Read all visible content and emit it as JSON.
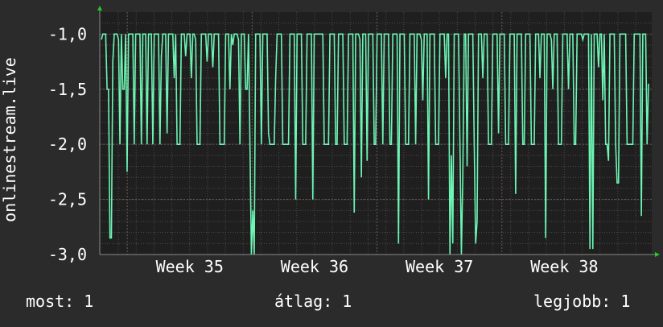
{
  "chart_data": {
    "type": "line",
    "ylabel": "onlinestream.live",
    "ylim": [
      -3.0,
      -0.8
    ],
    "yticks": [
      "-1,0",
      "-1,5",
      "-2,0",
      "-2,5",
      "-3,0"
    ],
    "ytick_values": [
      -1.0,
      -1.5,
      -2.0,
      -2.5,
      -3.0
    ],
    "xticks": [
      "Week 35",
      "Week 36",
      "Week 37",
      "Week 38"
    ],
    "x": {
      "start_week": 34.28,
      "end_week": 38.7
    },
    "series": [
      {
        "values": [
          -1.05,
          -1.0,
          -1.0,
          -1.0,
          -1.5,
          -1.5,
          -2.85,
          -2.85,
          -1.25,
          -1.0,
          -1.0,
          -1.0,
          -1.05,
          -2.0,
          -1.0,
          -1.5,
          -1.5,
          -1.0,
          -2.25,
          -1.0,
          -1.0,
          -1.0,
          -1.0,
          -2.0,
          -1.0,
          -1.0,
          -1.0,
          -1.0,
          -2.0,
          -1.0,
          -1.0,
          -1.0,
          -2.0,
          -1.0,
          -1.0,
          -1.0,
          -2.0,
          -1.0,
          -1.0,
          -1.0,
          -1.0,
          -2.0,
          -1.2,
          -1.0,
          -1.0,
          -1.0,
          -1.9,
          -1.0,
          -1.0,
          -1.0,
          -1.0,
          -1.4,
          -1.0,
          -2.0,
          -2.0,
          -2.0,
          -1.0,
          -1.0,
          -1.0,
          -1.2,
          -1.0,
          -1.0,
          -1.0,
          -1.4,
          -1.0,
          -1.0,
          -1.05,
          -2.0,
          -2.0,
          -2.0,
          -1.0,
          -1.0,
          -1.0,
          -1.0,
          -1.25,
          -1.0,
          -1.0,
          -1.0,
          -1.3,
          -1.0,
          -1.0,
          -1.0,
          -1.0,
          -2.0,
          -2.0,
          -2.0,
          -2.0,
          -1.0,
          -1.0,
          -1.0,
          -1.5,
          -1.0,
          -1.1,
          -1.0,
          -1.0,
          -1.0,
          -1.05,
          -2.0,
          -1.0,
          -1.0,
          -1.0,
          -1.5,
          -1.5,
          -1.0,
          -2.0,
          -3.0,
          -2.6,
          -3.0,
          -1.0,
          -1.0,
          -1.0,
          -1.0,
          -2.0,
          -1.0,
          -1.0,
          -1.0,
          -1.0,
          -1.9,
          -2.0,
          -2.0,
          -2.0,
          -2.0,
          -1.4,
          -1.0,
          -1.0,
          -1.0,
          -1.0,
          -2.0,
          -2.0,
          -2.0,
          -2.0,
          -2.0,
          -1.0,
          -1.0,
          -1.0,
          -1.0,
          -2.5,
          -1.0,
          -1.0,
          -1.0,
          -1.0,
          -2.0,
          -2.0,
          -2.0,
          -1.0,
          -1.0,
          -1.0,
          -1.0,
          -2.5,
          -1.0,
          -1.0,
          -1.0,
          -1.0,
          -1.0,
          -1.0,
          -1.0,
          -2.0,
          -2.0,
          -2.0,
          -2.0,
          -1.0,
          -1.0,
          -1.0,
          -1.0,
          -2.0,
          -2.0,
          -1.0,
          -1.0,
          -1.0,
          -1.0,
          -2.0,
          -2.0,
          -2.0,
          -1.0,
          -1.0,
          -1.0,
          -1.0,
          -2.62,
          -1.0,
          -1.0,
          -1.0,
          -1.05,
          -2.3,
          -1.0,
          -1.0,
          -1.0,
          -2.15,
          -1.0,
          -1.0,
          -1.0,
          -1.0,
          -2.0,
          -2.0,
          -1.0,
          -1.0,
          -1.0,
          -1.0,
          -2.0,
          -1.0,
          -1.0,
          -1.0,
          -1.0,
          -2.0,
          -2.0,
          -1.0,
          -1.0,
          -1.0,
          -1.0,
          -2.9,
          -1.0,
          -1.0,
          -1.0,
          -1.0,
          -2.0,
          -2.0,
          -2.0,
          -1.0,
          -1.0,
          -1.0,
          -1.0,
          -2.0,
          -1.0,
          -1.0,
          -1.0,
          -1.05,
          -1.6,
          -1.0,
          -1.0,
          -1.0,
          -2.5,
          -1.0,
          -1.0,
          -1.0,
          -1.0,
          -2.0,
          -2.0,
          -2.0,
          -1.0,
          -1.0,
          -1.0,
          -1.0,
          -1.4,
          -1.0,
          -1.0,
          -3.0,
          -2.1,
          -2.9,
          -1.0,
          -1.0,
          -1.0,
          -1.0,
          -2.0,
          -3.0,
          -2.3,
          -1.0,
          -1.0,
          -2.2,
          -1.0,
          -1.0,
          -1.0,
          -1.0,
          -2.0,
          -2.9,
          -2.7,
          -1.0,
          -1.0,
          -1.0,
          -1.4,
          -1.0,
          -1.0,
          -1.0,
          -2.0,
          -2.0,
          -2.0,
          -1.0,
          -1.0,
          -1.0,
          -1.0,
          -1.9,
          -1.0,
          -1.0,
          -1.0,
          -1.0,
          -2.0,
          -2.0,
          -2.0,
          -1.0,
          -1.0,
          -1.0,
          -1.0,
          -2.45,
          -1.0,
          -1.0,
          -1.0,
          -1.0,
          -2.0,
          -2.0,
          -1.0,
          -1.0,
          -1.0,
          -1.0,
          -2.0,
          -2.0,
          -2.0,
          -1.0,
          -1.0,
          -1.0,
          -1.4,
          -1.0,
          -1.0,
          -1.0,
          -2.85,
          -1.0,
          -1.0,
          -1.0,
          -1.05,
          -1.5,
          -1.0,
          -1.0,
          -1.0,
          -2.0,
          -2.0,
          -2.0,
          -1.0,
          -1.0,
          -1.0,
          -1.0,
          -1.5,
          -1.0,
          -1.0,
          -1.0,
          -2.0,
          -2.0,
          -1.0,
          -1.0,
          -1.0,
          -1.0,
          -1.05,
          -1.0,
          -1.0,
          -1.0,
          -1.0,
          -2.95,
          -1.0,
          -2.95,
          -1.0,
          -1.0,
          -1.0,
          -1.3,
          -1.0,
          -1.0,
          -1.6,
          -1.0,
          -2.0,
          -2.0,
          -2.15,
          -1.0,
          -1.0,
          -1.0,
          -1.0,
          -2.0,
          -2.35,
          -2.35,
          -1.0,
          -1.0,
          -1.0,
          -1.0,
          -1.0,
          -2.0,
          -2.0,
          -2.0,
          -2.0,
          -2.0,
          -1.0,
          -1.0,
          -1.0,
          -1.0,
          -1.0,
          -2.65,
          -1.0,
          -1.0,
          -1.0,
          -2.0,
          -1.45
        ]
      }
    ],
    "grid": true,
    "colors": {
      "background": "#2b2b2b",
      "plot_background": "#1f1f1f",
      "line": "#6df5b4",
      "grid": "#524848",
      "axis_arrow": "#22cc22"
    }
  },
  "legend": {
    "now_text": "most: 1",
    "avg_text": "átlag: 1",
    "max_text": "legjobb: 1"
  }
}
